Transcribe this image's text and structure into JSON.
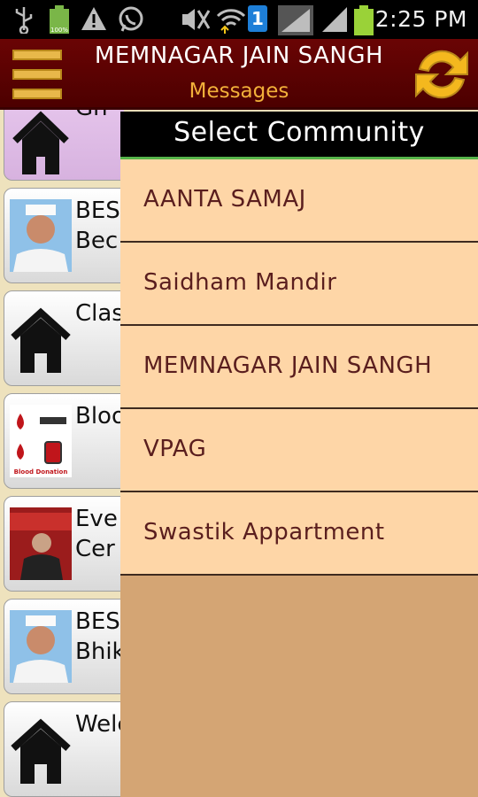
{
  "status_bar": {
    "time": "2:25 PM",
    "battery_level_label": "100%",
    "notification_count": "1",
    "icons": [
      "usb-icon",
      "battery-full-icon",
      "warning-icon",
      "whatsapp-icon",
      "mute-icon",
      "wifi-icon",
      "sim-badge-icon",
      "signal-icon",
      "battery-icon"
    ]
  },
  "action_bar": {
    "title": "MEMNAGAR JAIN SANGH",
    "subtitle": "Messages",
    "menu_icon": "hamburger-menu-icon",
    "refresh_icon": "refresh-icon",
    "colors": {
      "background": "#5c0000",
      "subtitle": "#f2b03a",
      "icon": "#e8b84a"
    }
  },
  "background_list": {
    "items": [
      {
        "text_line1": "Gh",
        "text_line2": "",
        "thumb": "home-icon"
      },
      {
        "text_line1": "BES",
        "text_line2": "Bec",
        "thumb": "person-photo"
      },
      {
        "text_line1": "Clas",
        "text_line2": "",
        "thumb": "home-icon"
      },
      {
        "text_line1": "Bloo",
        "text_line2": "",
        "thumb": "blood-donation-image",
        "thumb_caption": "Blood Donation"
      },
      {
        "text_line1": "Eve",
        "text_line2": "Cer",
        "thumb": "event-photo"
      },
      {
        "text_line1": "BES",
        "text_line2": "Bhik",
        "thumb": "person-photo"
      },
      {
        "text_line1": "Welc",
        "text_line2": "",
        "thumb": "home-icon"
      }
    ]
  },
  "drawer": {
    "title": "Select Community",
    "items": [
      {
        "label": "AANTA SAMAJ"
      },
      {
        "label": "Saidham Mandir"
      },
      {
        "label": "MEMNAGAR JAIN SANGH"
      },
      {
        "label": "VPAG"
      },
      {
        "label": "Swastik Appartment"
      }
    ],
    "colors": {
      "item_background": "#fed6a7",
      "item_text": "#5a1e1e",
      "header_accent": "#56b44a",
      "drawer_background": "#d4a574"
    }
  }
}
